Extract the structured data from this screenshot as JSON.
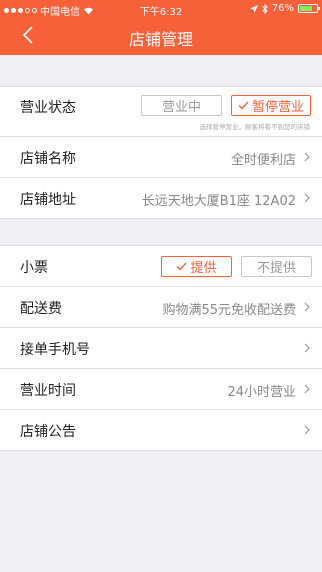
{
  "status_bar": {
    "carrier": "中国电信",
    "time": "下午6:32",
    "battery": "76%",
    "battery_level": 0.76
  },
  "header": {
    "title": "店铺管理",
    "back_icon": "chevron-left-icon"
  },
  "business_status": {
    "label": "营业状态",
    "option_open": "营业中",
    "option_pause": "暂停营业",
    "selected": "暂停营业",
    "hint": "选择暂停营业，顾客将看不到您的店铺"
  },
  "store_name": {
    "label": "店铺名称",
    "value": "全时便利店"
  },
  "store_address": {
    "label": "店铺地址",
    "value": "长远天地大厦B1座 12A02"
  },
  "receipt": {
    "label": "小票",
    "option_yes": "提供",
    "option_no": "不提供",
    "selected": "提供"
  },
  "delivery_fee": {
    "label": "配送费",
    "value": "购物满55元免收配送费"
  },
  "order_phone": {
    "label": "接单手机号",
    "value": ""
  },
  "business_hours": {
    "label": "营业时间",
    "value": "24小时营业"
  },
  "store_notice": {
    "label": "店铺公告",
    "value": ""
  },
  "colors": {
    "accent": "#f6613a",
    "background": "#efeff4"
  }
}
